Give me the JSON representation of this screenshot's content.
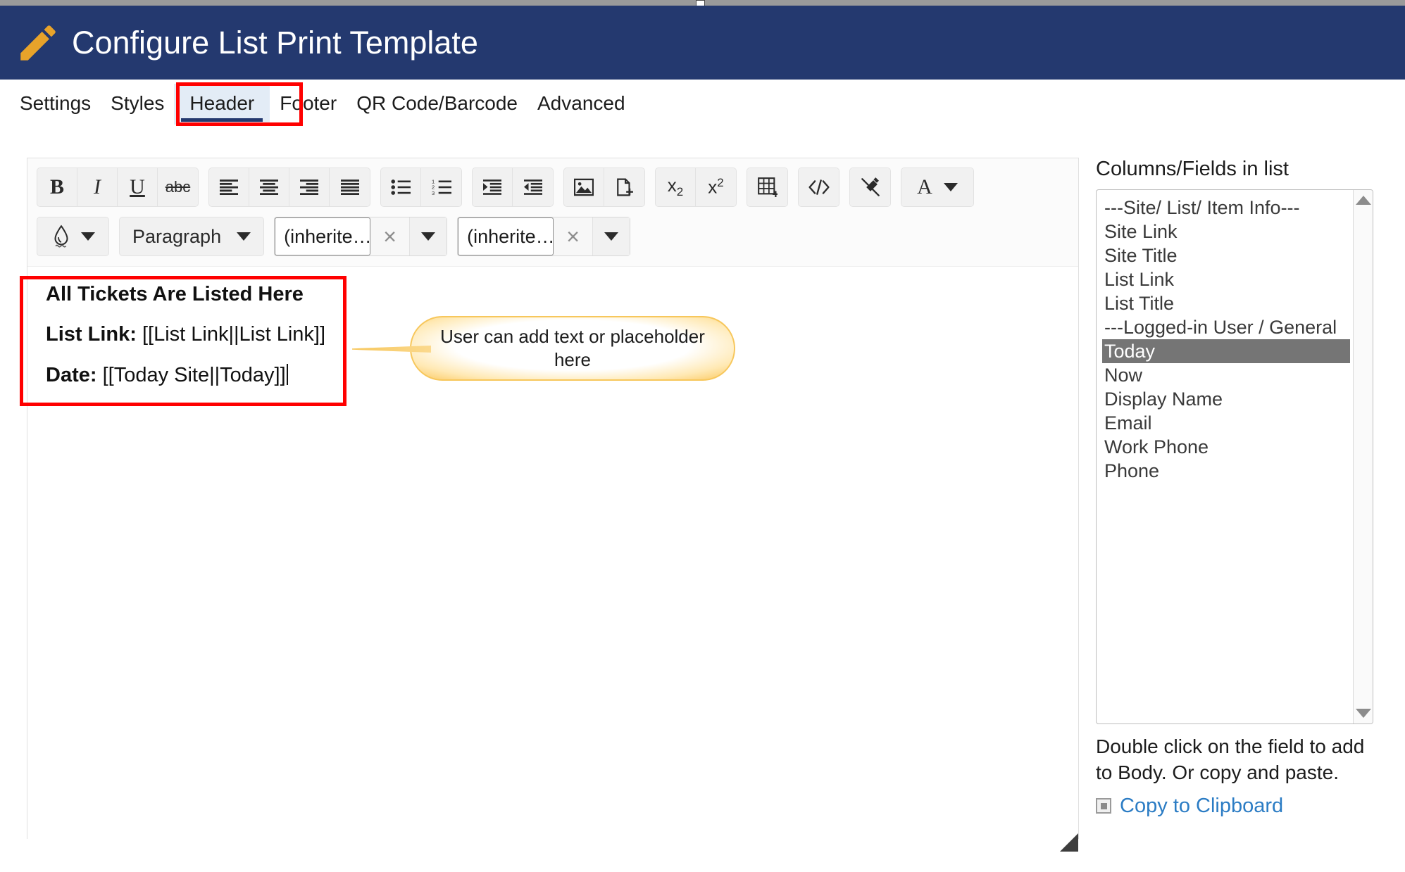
{
  "header": {
    "title": "Configure List Print Template",
    "icon": "pencil-icon",
    "bg_color": "#24396f",
    "icon_color": "#e8a32a"
  },
  "tabs": [
    {
      "label": "Settings",
      "active": false
    },
    {
      "label": "Styles",
      "active": false
    },
    {
      "label": "Header",
      "active": true
    },
    {
      "label": "Footer",
      "active": false
    },
    {
      "label": "QR Code/Barcode",
      "active": false
    },
    {
      "label": "Advanced",
      "active": false
    }
  ],
  "toolbar": {
    "row1": [
      {
        "icons": [
          "bold-icon",
          "italic-icon",
          "underline-icon",
          "strikethrough-icon"
        ]
      },
      {
        "icons": [
          "align-left-icon",
          "align-center-icon",
          "align-right-icon",
          "align-justify-icon"
        ]
      },
      {
        "icons": [
          "bulleted-list-icon",
          "numbered-list-icon"
        ]
      },
      {
        "icons": [
          "indent-increase-icon",
          "indent-decrease-icon"
        ]
      },
      {
        "icons": [
          "insert-image-icon",
          "insert-file-icon"
        ]
      },
      {
        "icons": [
          "subscript-icon",
          "superscript-icon"
        ]
      },
      {
        "icons": [
          "insert-table-icon"
        ]
      },
      {
        "icons": [
          "source-code-icon"
        ]
      },
      {
        "icons": [
          "remove-format-icon"
        ]
      },
      {
        "icons": [
          "font-color-icon",
          "font-color-caret-icon"
        ]
      }
    ],
    "row2": {
      "highlight_label": "highlight-color-icon",
      "paragraph_label": "Paragraph",
      "font_family_value": "(inherite…",
      "font_size_value": "(inherite…",
      "clear_symbol": "×"
    }
  },
  "editor": {
    "line1": "All Tickets Are Listed Here",
    "line2_label": "List Link:",
    "line2_value": "[[List Link||List Link]]",
    "line3_label": "Date:",
    "line3_value": "[[Today Site||Today]]"
  },
  "callout": {
    "text": "User can add text or placeholder here",
    "border_color": "#f7c75c"
  },
  "annotations": {
    "box_color": "#ff0000"
  },
  "right_panel": {
    "title": "Columns/Fields in list",
    "items": [
      {
        "label": "---Site/ List/ Item Info---",
        "selected": false
      },
      {
        "label": "Site Link",
        "selected": false
      },
      {
        "label": "Site Title",
        "selected": false
      },
      {
        "label": "List Link",
        "selected": false
      },
      {
        "label": "List Title",
        "selected": false
      },
      {
        "label": "---Logged-in User / General",
        "selected": false
      },
      {
        "label": "Today",
        "selected": true
      },
      {
        "label": "Now",
        "selected": false
      },
      {
        "label": "Display Name",
        "selected": false
      },
      {
        "label": "Email",
        "selected": false
      },
      {
        "label": "Work Phone",
        "selected": false
      },
      {
        "label": "Phone",
        "selected": false
      }
    ],
    "hint": "Double click on the field to add to Body. Or copy and paste.",
    "copy_link": "Copy to Clipboard",
    "copy_link_color": "#2b7cc4"
  }
}
